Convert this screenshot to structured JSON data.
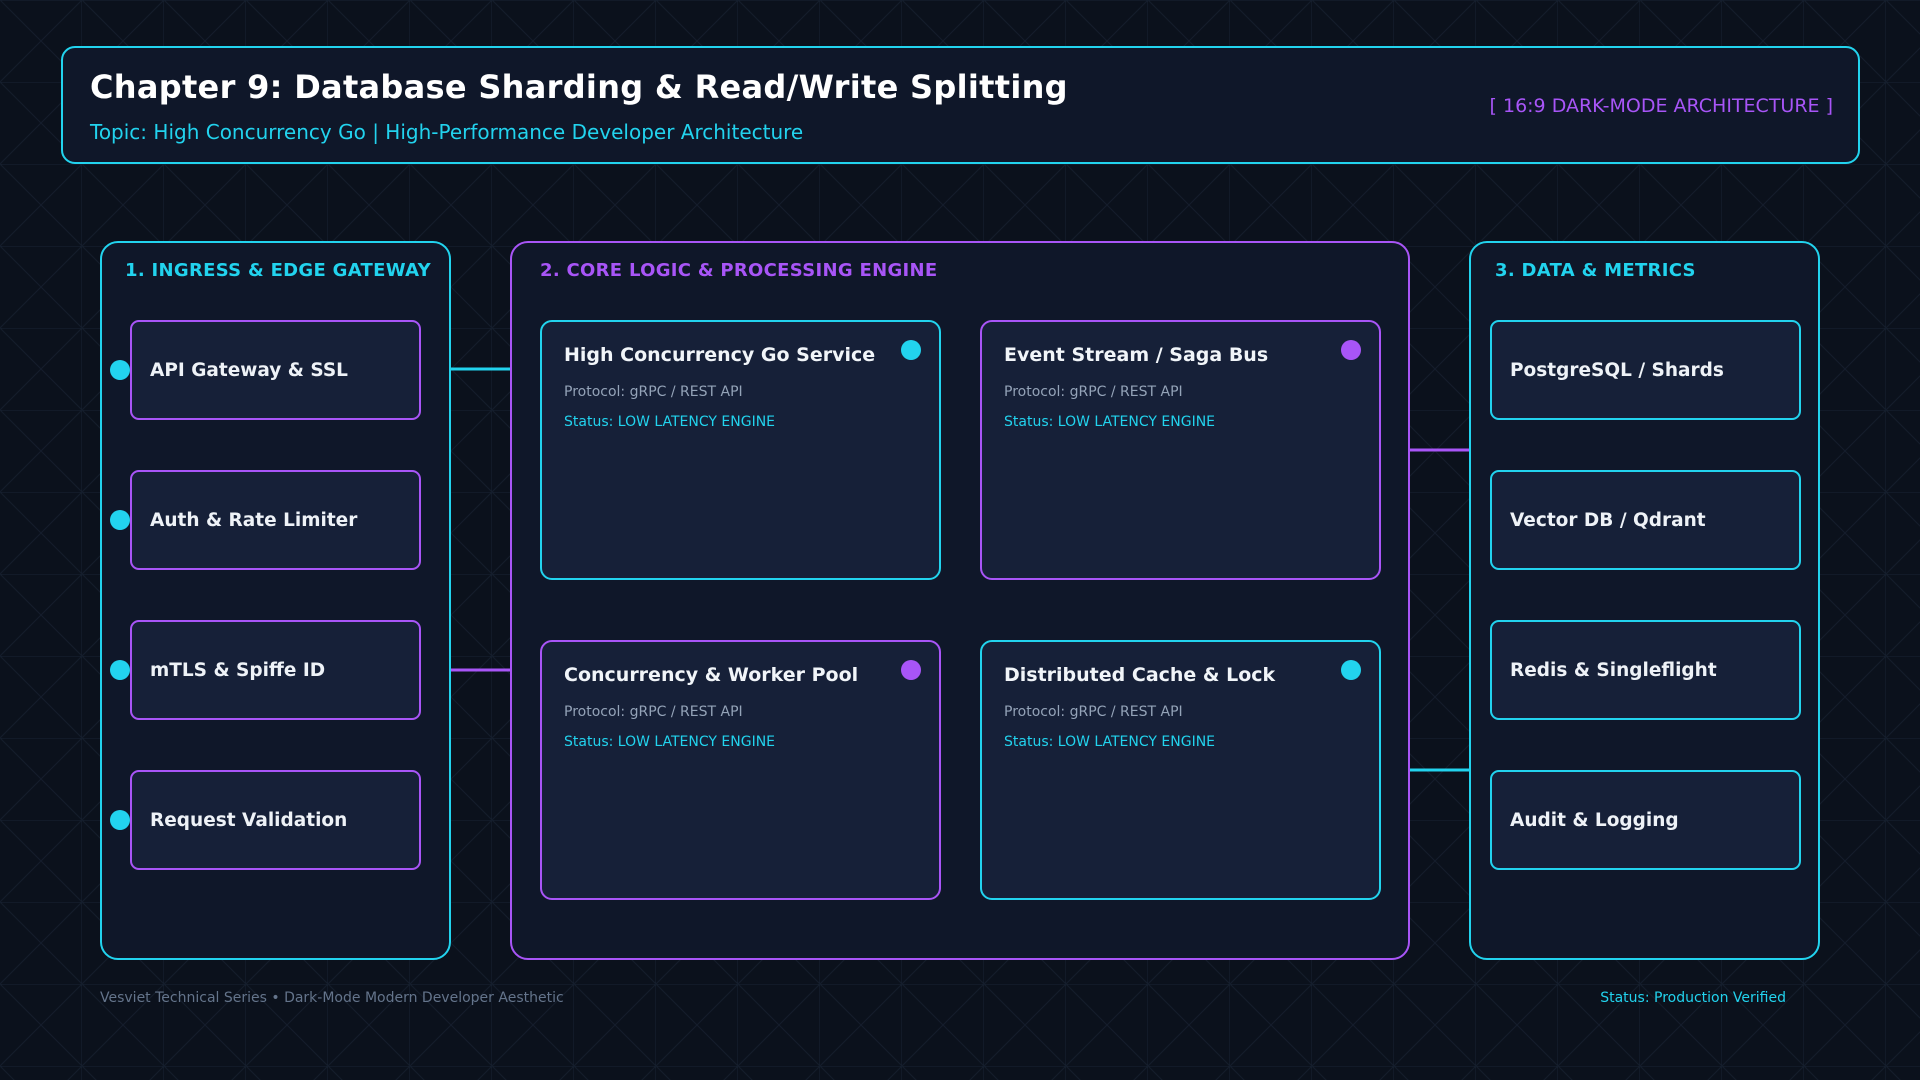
{
  "header": {
    "title": "Chapter 9: Database Sharding & Read/Write Splitting",
    "subtitle": "Topic: High Concurrency Go | High-Performance Developer Architecture",
    "tag": "[ 16:9 DARK-MODE ARCHITECTURE ]"
  },
  "colors": {
    "background": "#0b111c",
    "cyan": "#22d3ee",
    "purple": "#a855f7",
    "card": "#162038",
    "panel": "#0f1729"
  },
  "ingress": {
    "title": "1. INGRESS & EDGE GATEWAY",
    "items": [
      "API Gateway & SSL",
      "Auth & Rate Limiter",
      "mTLS & Spiffe ID",
      "Request Validation"
    ]
  },
  "core": {
    "title": "2. CORE LOGIC & PROCESSING ENGINE",
    "cards": [
      {
        "title": "High Concurrency Go Service",
        "protocol": "Protocol: gRPC / REST API",
        "status": "Status: LOW LATENCY ENGINE"
      },
      {
        "title": "Event Stream / Saga Bus",
        "protocol": "Protocol: gRPC / REST API",
        "status": "Status: LOW LATENCY ENGINE"
      },
      {
        "title": "Concurrency & Worker Pool",
        "protocol": "Protocol: gRPC / REST API",
        "status": "Status: LOW LATENCY ENGINE"
      },
      {
        "title": "Distributed Cache & Lock",
        "protocol": "Protocol: gRPC / REST API",
        "status": "Status: LOW LATENCY ENGINE"
      }
    ]
  },
  "data": {
    "title": "3. DATA & METRICS",
    "items": [
      "PostgreSQL / Shards",
      "Vector DB / Qdrant",
      "Redis & Singleflight",
      "Audit & Logging"
    ]
  },
  "footer": {
    "left": "Vesviet Technical Series • Dark-Mode Modern Developer Aesthetic",
    "right": "Status: Production Verified"
  }
}
